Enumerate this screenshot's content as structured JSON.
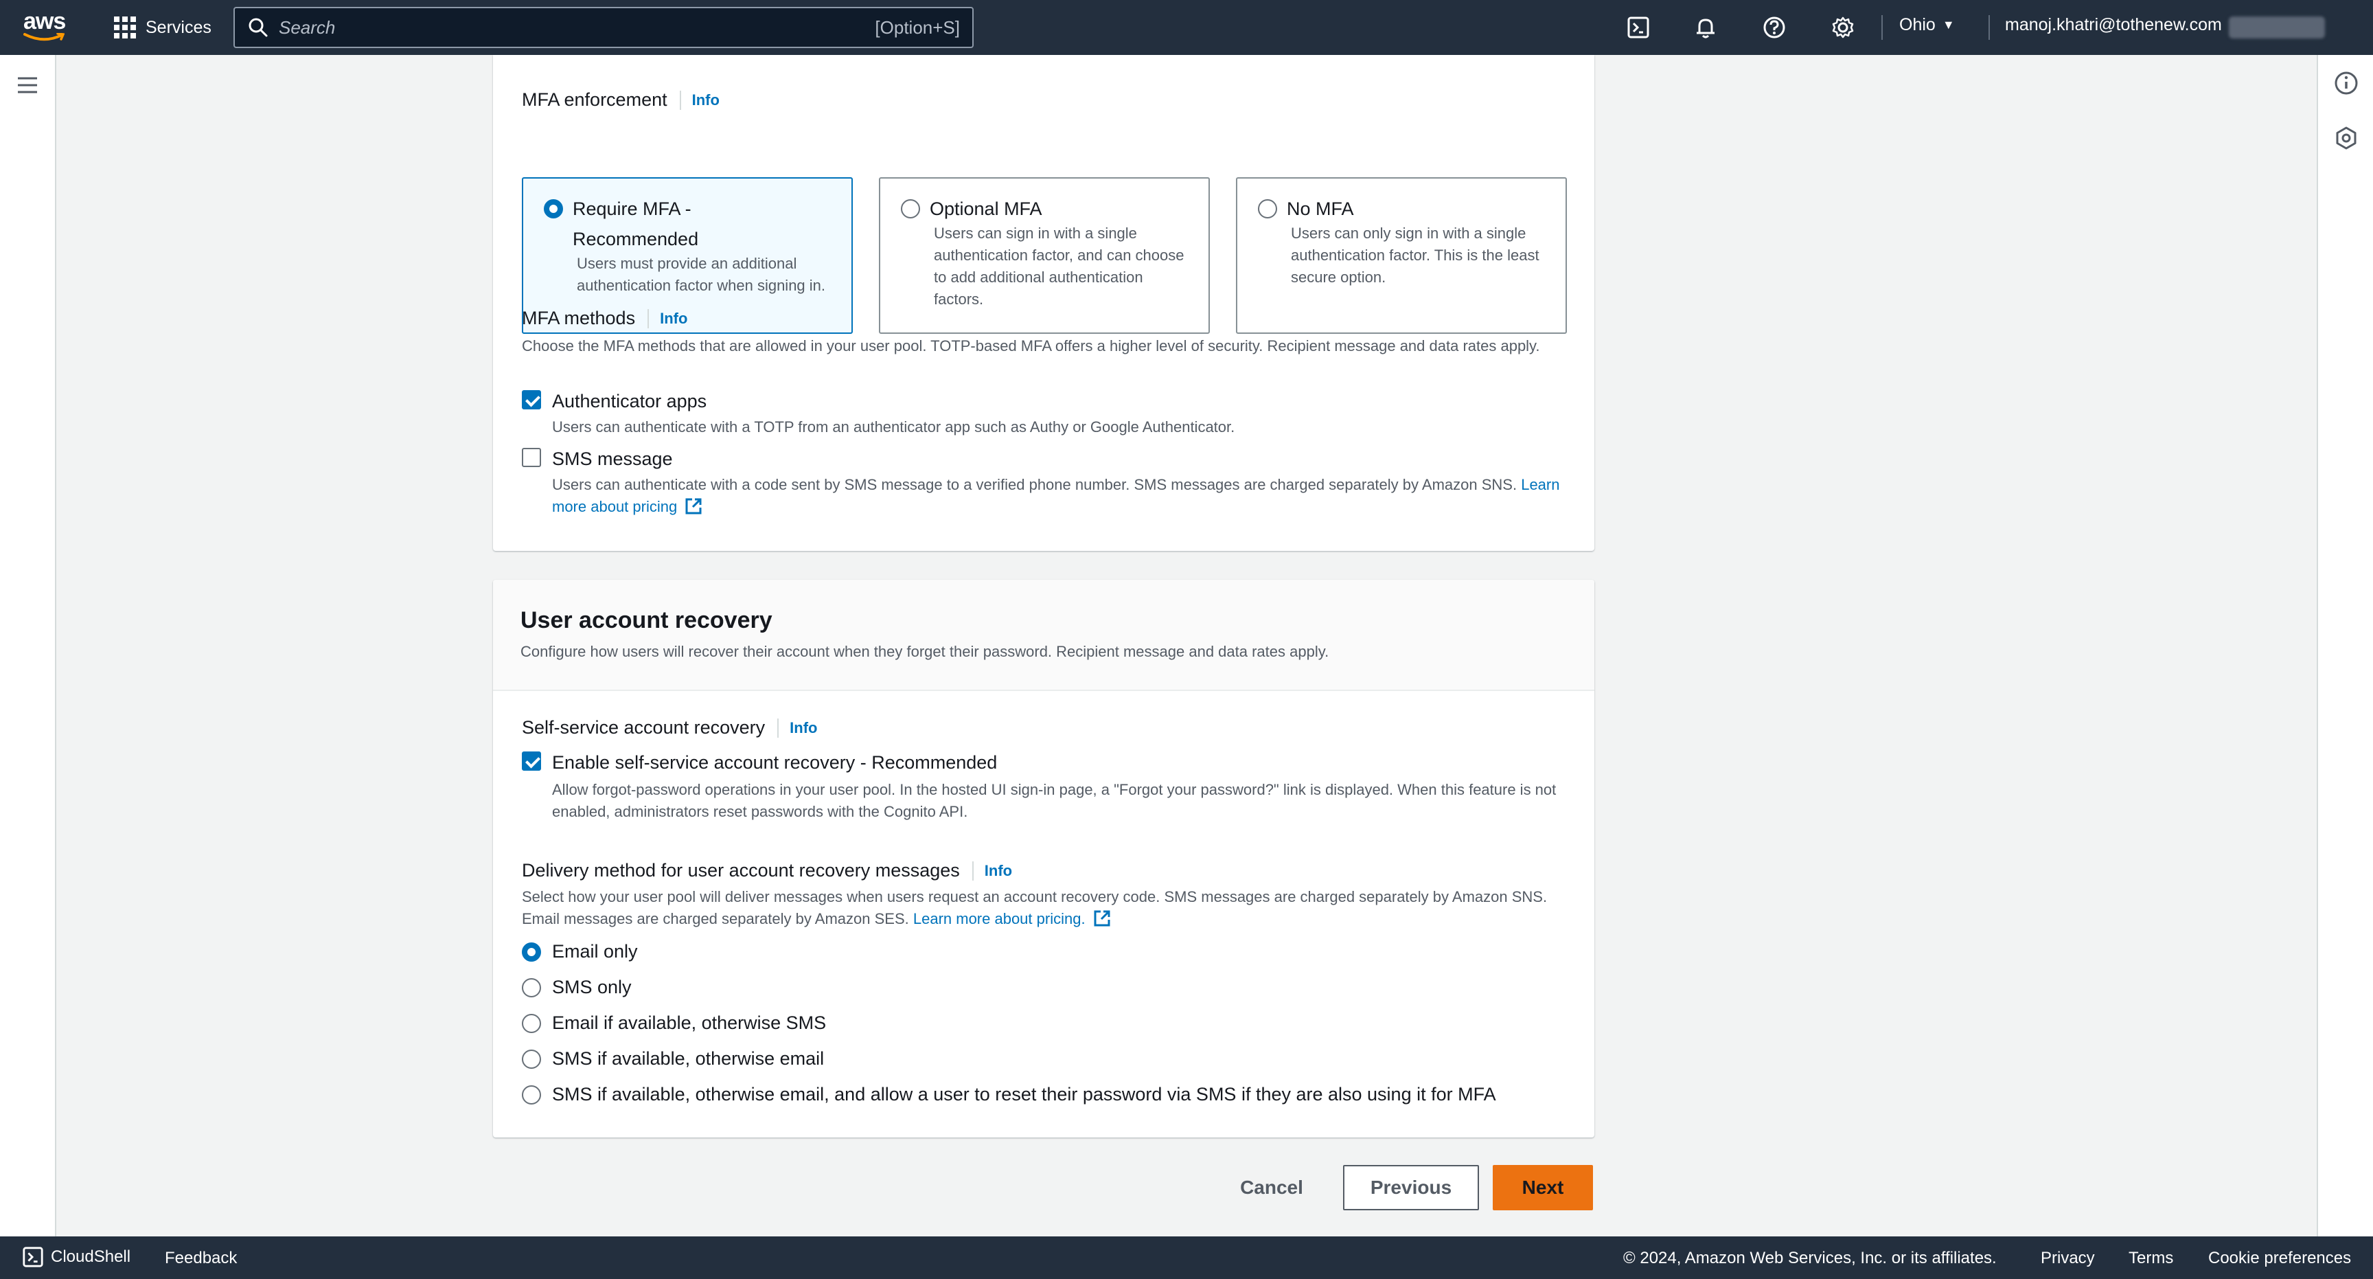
{
  "nav": {
    "logo_text": "aws",
    "services_label": "Services",
    "search_placeholder": "Search",
    "search_shortcut": "[Option+S]",
    "icons": [
      "cloudshell-icon",
      "bell-icon",
      "help-icon",
      "settings-icon"
    ],
    "region": "Ohio",
    "account": "manoj.khatri@tothenew.com"
  },
  "mfa": {
    "enforcement_label": "MFA enforcement",
    "info": "Info",
    "options": [
      {
        "title": "Require MFA - Recommended",
        "description": "Users must provide an additional authentication factor when signing in.",
        "selected": true
      },
      {
        "title": "Optional MFA",
        "description": "Users can sign in with a single authentication factor, and can choose to add additional authentication factors.",
        "selected": false
      },
      {
        "title": "No MFA",
        "description": "Users can only sign in with a single authentication factor. This is the least secure option.",
        "selected": false
      }
    ],
    "methods_label": "MFA methods",
    "methods_description": "Choose the MFA methods that are allowed in your user pool. TOTP-based MFA offers a higher level of security. Recipient message and data rates apply.",
    "methods": [
      {
        "label": "Authenticator apps",
        "description": "Users can authenticate with a TOTP from an authenticator app such as Authy or Google Authenticator.",
        "checked": true
      },
      {
        "label": "SMS message",
        "description": "Users can authenticate with a code sent by SMS message to a verified phone number. SMS messages are charged separately by Amazon SNS.",
        "link": "Learn more about pricing",
        "checked": false
      }
    ]
  },
  "recovery": {
    "title": "User account recovery",
    "description": "Configure how users will recover their account when they forget their password. Recipient message and data rates apply.",
    "self_service_label": "Self-service account recovery",
    "info": "Info",
    "self_service_option": "Enable self-service account recovery - Recommended",
    "self_service_description": "Allow forgot-password operations in your user pool. In the hosted UI sign-in page, a \"Forgot your password?\" link is displayed. When this feature is not enabled, administrators reset passwords with the Cognito API.",
    "delivery_label": "Delivery method for user account recovery messages",
    "delivery_description": "Select how your user pool will deliver messages when users request an account recovery code. SMS messages are charged separately by Amazon SNS. Email messages are charged separately by Amazon SES.",
    "delivery_link": "Learn more about pricing.",
    "delivery_options": [
      {
        "label": "Email only",
        "selected": true
      },
      {
        "label": "SMS only",
        "selected": false
      },
      {
        "label": "Email if available, otherwise SMS",
        "selected": false
      },
      {
        "label": "SMS if available, otherwise email",
        "selected": false
      },
      {
        "label": "SMS if available, otherwise email, and allow a user to reset their password via SMS if they are also using it for MFA",
        "selected": false
      }
    ]
  },
  "actions": {
    "cancel": "Cancel",
    "previous": "Previous",
    "next": "Next"
  },
  "footer": {
    "cloudshell": "CloudShell",
    "feedback": "Feedback",
    "copyright": "© 2024, Amazon Web Services, Inc. or its affiliates.",
    "privacy": "Privacy",
    "terms": "Terms",
    "cookies": "Cookie preferences"
  },
  "colors": {
    "nav_bg": "#232f3e",
    "accent": "#0073bb",
    "primary_button": "#ec7211"
  }
}
